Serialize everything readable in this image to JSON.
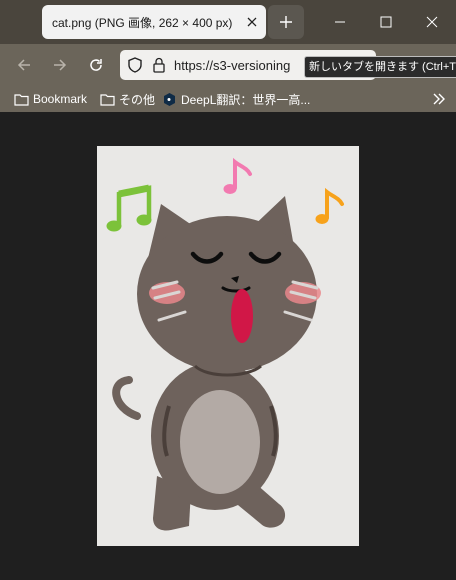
{
  "tab": {
    "title": "cat.png (PNG 画像, 262 × 400 px)"
  },
  "address_bar": {
    "url": "https://s3-versioning"
  },
  "tooltip": {
    "text": "新しいタブを開きます (Ctrl+T)"
  },
  "bookmarks": [
    {
      "label": "Bookmark",
      "icon": "folder-icon"
    },
    {
      "label": "その他",
      "icon": "folder-icon"
    },
    {
      "label": "DeepL翻訳：世界一高...",
      "icon": "deepl-icon"
    }
  ],
  "colors": {
    "tabbar": "#4a453d",
    "toolbar": "#6b655a",
    "content_bg": "#1f1f1f",
    "cat_body": "#6e625c",
    "note_green": "#7cc23a",
    "note_pink": "#f27ab0",
    "note_orange": "#f7a21b"
  }
}
